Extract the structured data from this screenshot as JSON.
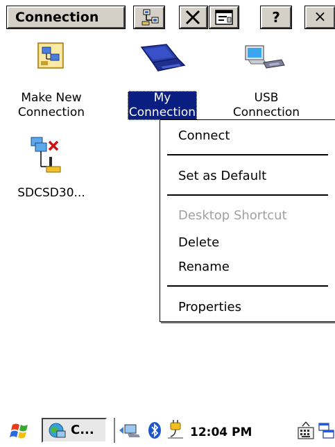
{
  "toolbar": {
    "title": "Connection",
    "help_label": "?",
    "close_label": "×"
  },
  "desktop": {
    "items": [
      {
        "label": "Make New\nConnection"
      },
      {
        "label": "My\nConnection"
      },
      {
        "label": "USB\nConnection"
      },
      {
        "label": "SDCSD30..."
      }
    ]
  },
  "context_menu": {
    "connect": "Connect",
    "set_default": "Set as Default",
    "desktop_shortcut": "Desktop Shortcut",
    "delete": "Delete",
    "rename": "Rename",
    "properties": "Properties"
  },
  "taskbar": {
    "task_label": "C...",
    "clock": "12:04 PM"
  },
  "colors": {
    "selection": "#0a1e82",
    "disabled_text": "#a0a0a0"
  }
}
